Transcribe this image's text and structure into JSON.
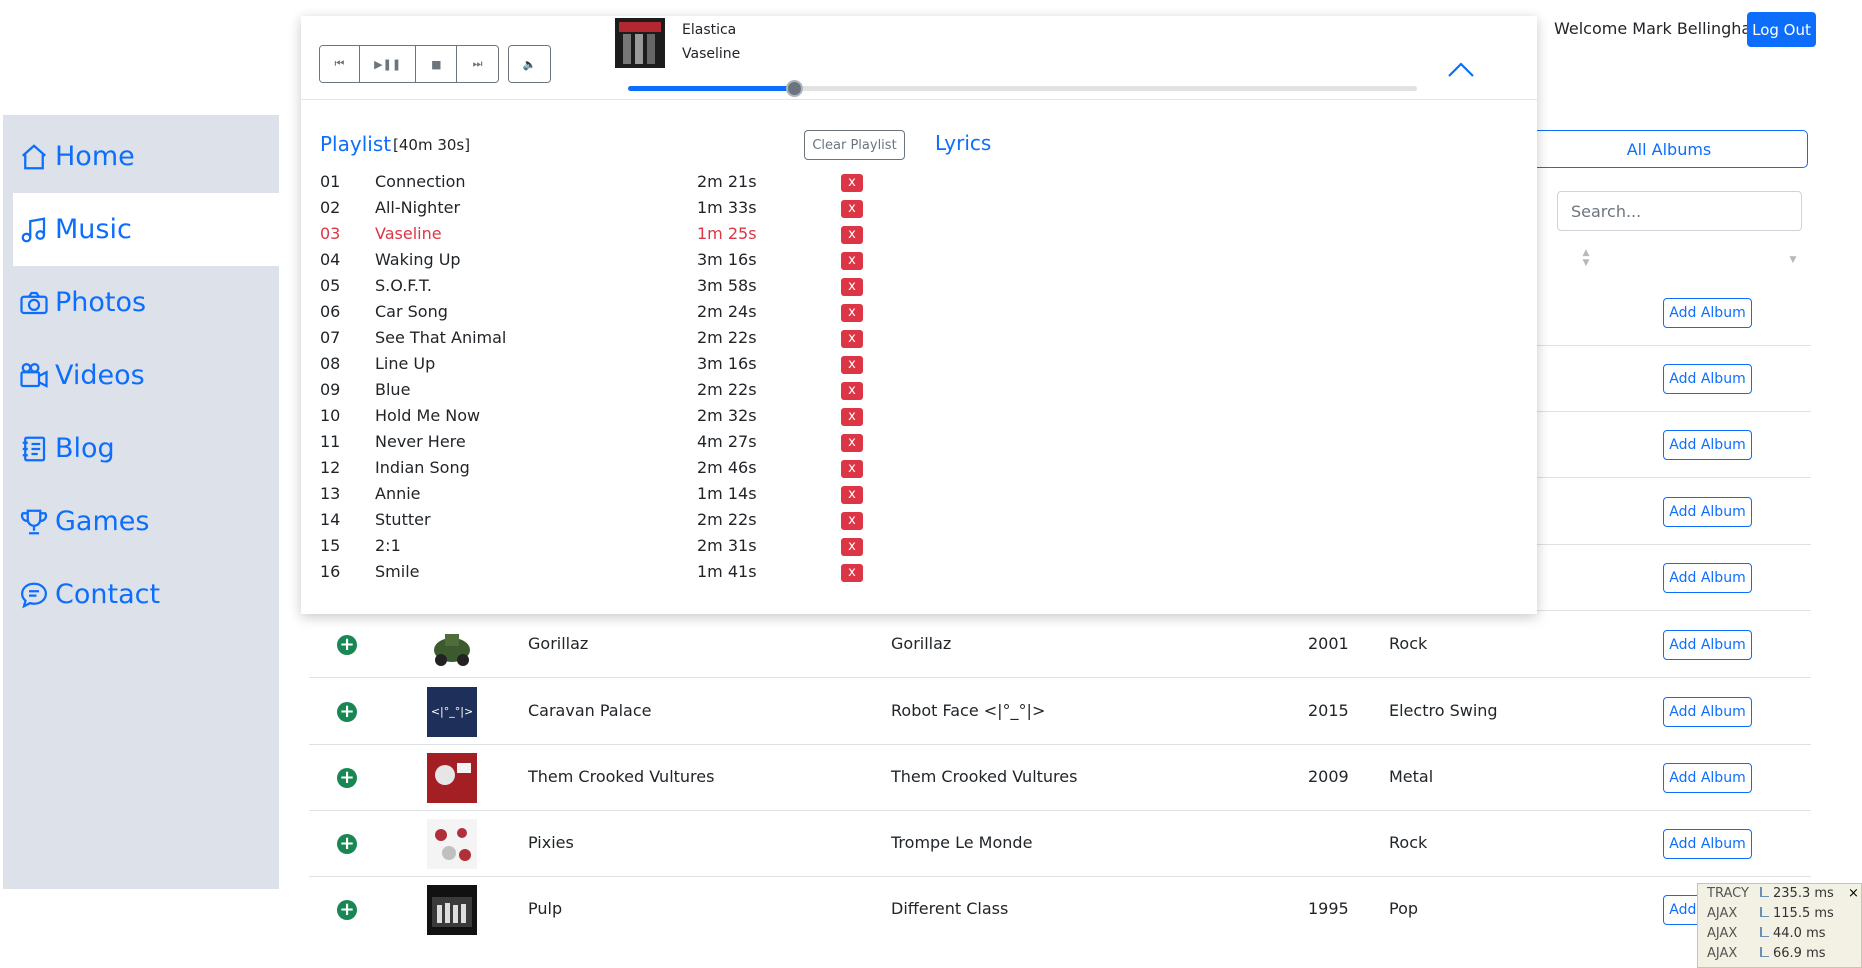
{
  "header": {
    "welcome": "Welcome Mark Bellingham",
    "logout_label": "Log Out"
  },
  "sidebar": {
    "items": [
      {
        "label": "Home",
        "icon": "home-icon"
      },
      {
        "label": "Music",
        "icon": "music-note-icon",
        "active": true
      },
      {
        "label": "Photos",
        "icon": "camera-icon"
      },
      {
        "label": "Videos",
        "icon": "video-camera-icon"
      },
      {
        "label": "Blog",
        "icon": "journal-icon"
      },
      {
        "label": "Games",
        "icon": "trophy-icon"
      },
      {
        "label": "Contact",
        "icon": "chat-icon"
      }
    ]
  },
  "controls": {
    "all_albums_label": "All Albums",
    "search_placeholder": "Search..."
  },
  "albums": [
    {
      "artist": "Gorillaz",
      "title": "Gorillaz",
      "year": "2001",
      "genre": "Rock",
      "button": "Add Album"
    },
    {
      "artist": "Caravan Palace",
      "title": "Robot Face <|°_°|>",
      "year": "2015",
      "genre": "Electro Swing",
      "button": "Add Album",
      "thumb_text": "<|°_°|>"
    },
    {
      "artist": "Them Crooked Vultures",
      "title": "Them Crooked Vultures",
      "year": "2009",
      "genre": "Metal",
      "button": "Add Album"
    },
    {
      "artist": "Pixies",
      "title": "Trompe Le Monde",
      "year": "",
      "genre": "Rock",
      "button": "Add Album"
    },
    {
      "artist": "Pulp",
      "title": "Different Class",
      "year": "1995",
      "genre": "Pop",
      "button": "Add Album"
    }
  ],
  "hidden_rows_button": "Add Album",
  "player": {
    "now_playing": {
      "artist": "Elastica",
      "track": "Vaseline"
    },
    "progress": 0.21,
    "playlist_title": "Playlist",
    "playlist_total": "[40m 30s]",
    "clear_label": "Clear Playlist",
    "lyrics_title": "Lyrics",
    "remove_label": "x",
    "tracks": [
      {
        "num": "01",
        "name": "Connection",
        "dur": "2m 21s"
      },
      {
        "num": "02",
        "name": "All-Nighter",
        "dur": "1m 33s"
      },
      {
        "num": "03",
        "name": "Vaseline",
        "dur": "1m 25s",
        "current": true
      },
      {
        "num": "04",
        "name": "Waking Up",
        "dur": "3m 16s"
      },
      {
        "num": "05",
        "name": "S.O.F.T.",
        "dur": "3m 58s"
      },
      {
        "num": "06",
        "name": "Car Song",
        "dur": "2m 24s"
      },
      {
        "num": "07",
        "name": "See That Animal",
        "dur": "2m 22s"
      },
      {
        "num": "08",
        "name": "Line Up",
        "dur": "3m 16s"
      },
      {
        "num": "09",
        "name": "Blue",
        "dur": "2m 22s"
      },
      {
        "num": "10",
        "name": "Hold Me Now",
        "dur": "2m 32s"
      },
      {
        "num": "11",
        "name": "Never Here",
        "dur": "4m 27s"
      },
      {
        "num": "12",
        "name": "Indian Song",
        "dur": "2m 46s"
      },
      {
        "num": "13",
        "name": "Annie",
        "dur": "1m 14s"
      },
      {
        "num": "14",
        "name": "Stutter",
        "dur": "2m 22s"
      },
      {
        "num": "15",
        "name": "2:1",
        "dur": "2m 31s"
      },
      {
        "num": "16",
        "name": "Smile",
        "dur": "1m 41s"
      }
    ]
  },
  "tracy": {
    "rows": [
      {
        "label": "TRACY",
        "value": "235.3 ms"
      },
      {
        "label": "AJAX",
        "value": "115.5 ms"
      },
      {
        "label": "AJAX",
        "value": "44.0 ms"
      },
      {
        "label": "AJAX",
        "value": "66.9 ms"
      }
    ],
    "close": "×"
  }
}
